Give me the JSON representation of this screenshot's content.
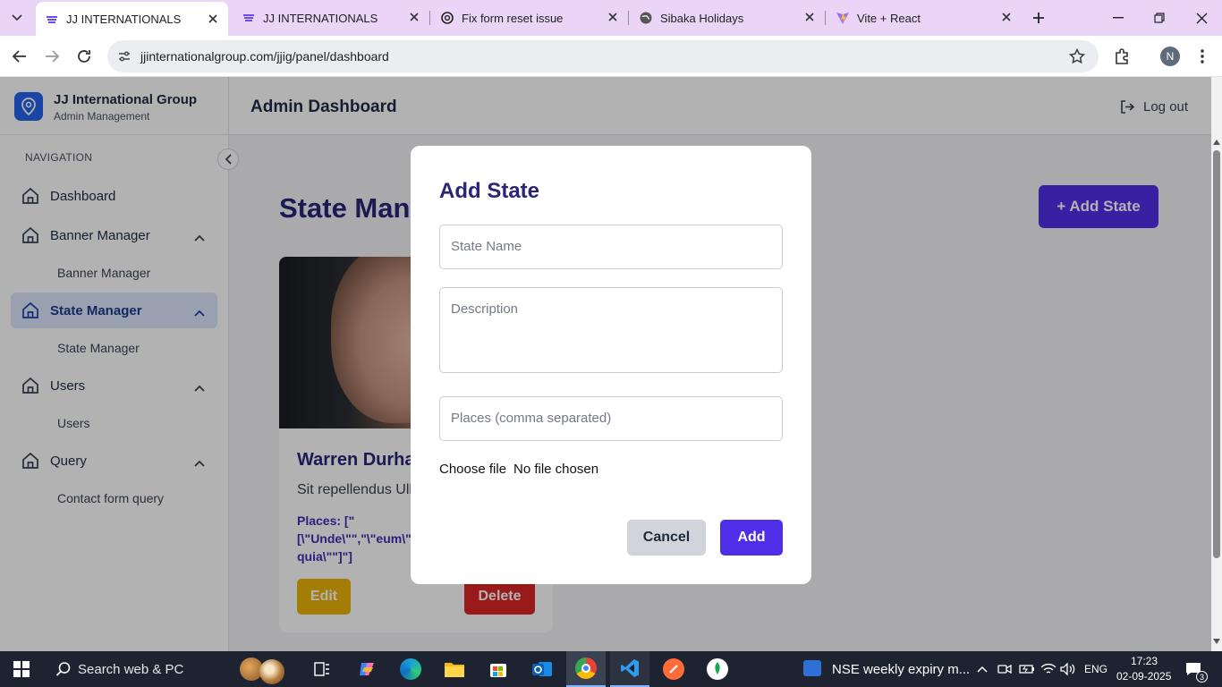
{
  "browser": {
    "tabs": [
      {
        "title": "JJ INTERNATIONALS",
        "active": true
      },
      {
        "title": "JJ INTERNATIONALS"
      },
      {
        "title": "Fix form reset issue"
      },
      {
        "title": "Sibaka Holidays"
      },
      {
        "title": "Vite + React"
      }
    ],
    "url": "jjinternationalgroup.com/jjig/panel/dashboard",
    "profile_initial": "N"
  },
  "sidebar": {
    "brand_title": "JJ International Group",
    "brand_subtitle": "Admin Management",
    "section_label": "NAVIGATION",
    "items": [
      {
        "label": "Dashboard"
      },
      {
        "label": "Banner Manager",
        "sub": "Banner Manager"
      },
      {
        "label": "State Manager",
        "sub": "State Manager",
        "active": true
      },
      {
        "label": "Users",
        "sub": "Users"
      },
      {
        "label": "Query",
        "sub": "Contact form query"
      }
    ]
  },
  "header": {
    "title": "Admin Dashboard",
    "logout": "Log out"
  },
  "main": {
    "heading": "State Man",
    "add_button": "+ Add State",
    "card": {
      "name": "Warren Durha",
      "description": "Sit repellendus Ull",
      "places_line1": "Places: [\"",
      "places_line2": "[\\\"Unde\\\"\",\"\\\"eum\\\"",
      "places_line3": "quia\\\"\"]\"]",
      "edit": "Edit",
      "delete": "Delete"
    }
  },
  "modal": {
    "title": "Add State",
    "state_name_placeholder": "State Name",
    "description_placeholder": "Description",
    "places_placeholder": "Places (comma separated)",
    "file_button": "Choose file",
    "file_status": "No file chosen",
    "cancel": "Cancel",
    "add": "Add"
  },
  "taskbar": {
    "search": "Search web & PC",
    "news": "NSE weekly expiry m...",
    "lang": "ENG",
    "time": "17:23",
    "date": "02-09-2025",
    "notif_count": "3"
  },
  "colors": {
    "primary": "#4f2ee8",
    "heading": "#2a2577",
    "edit": "#eab308",
    "delete": "#dc2626",
    "cancel_bg": "#d1d5db",
    "sidebar_active": "#dbe5fb"
  }
}
